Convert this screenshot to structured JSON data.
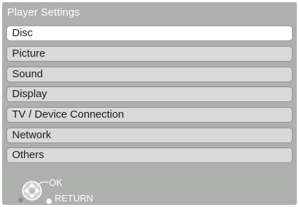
{
  "title": "Player Settings",
  "menu": [
    {
      "label": "Disc",
      "selected": true
    },
    {
      "label": "Picture",
      "selected": false
    },
    {
      "label": "Sound",
      "selected": false
    },
    {
      "label": "Display",
      "selected": false
    },
    {
      "label": "TV / Device Connection",
      "selected": false
    },
    {
      "label": "Network",
      "selected": false
    },
    {
      "label": "Others",
      "selected": false
    }
  ],
  "nav_hint": {
    "ok_label": "OK",
    "return_label": "RETURN",
    "icons": [
      "dpad-icon",
      "return-button-icon"
    ]
  },
  "colors": {
    "panel": "#aeb0ae",
    "item": "#d8d9d8",
    "item_selected": "#ffffff",
    "text": "#1a1a1a",
    "title_text": "#ffffff"
  }
}
